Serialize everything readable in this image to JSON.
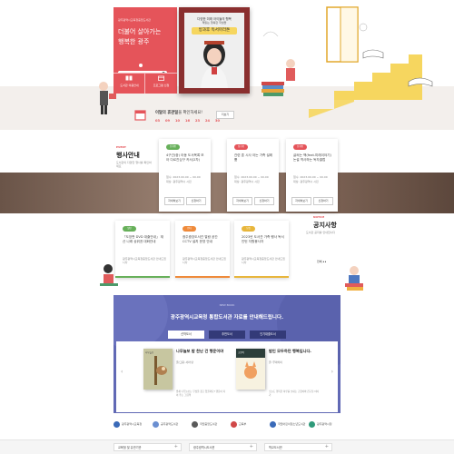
{
  "hero": {
    "red_top": "광주광역시교육청중앙도서관",
    "slogan_line1": "더불어 살아가는",
    "slogan_line2": "행복한 광주",
    "photo_caption_top": "다양한 미래 아이들의 행복",
    "photo_caption_sub": "책읽는 행복한 학생들",
    "photo_title": "방과후 독서마라톤",
    "tiles": [
      "도서관 이용안내",
      "프로그램 신청"
    ],
    "calendar_title": "이달의 휴관일",
    "calendar_suffix": "을 확인하세요!",
    "calendar_days": [
      "03",
      "09",
      "10",
      "16",
      "23",
      "24",
      "30"
    ],
    "calendar_more": "더보기"
  },
  "notices_a": {
    "section_title": "행사안내",
    "section_label": "EVENT",
    "section_desc": "도서관의 다양한 행사를 확인하세요",
    "more": "전체",
    "cards": [
      {
        "badge": "진행중",
        "title": "4구간(중) 아동 도서목록 모아 다르진심구 카서(2차)",
        "info1": "접수: 2023.00.00 ~ 00.00",
        "info2": "대상: 광주광역시 시민",
        "btn1": "자세히보기",
        "btn2": "신청하기"
      },
      {
        "badge": "접수중",
        "title": "관련 훈 시사 아는 가족 설레뿜",
        "info1": "접수: 2023.00.00 ~ 00.00",
        "info2": "대상: 광주광역시 시민",
        "btn1": "자세히보기",
        "btn2": "신청하기"
      },
      {
        "badge": "진행중",
        "title": "글써는 책(feat.미래이야기) 논설 역사하는 독자클럽",
        "info1": "접수: 2023.00.00 ~ 00.00",
        "info2": "대상: 광주광역시 시민",
        "btn1": "자세히보기",
        "btn2": "신청하기"
      }
    ]
  },
  "notices_b": {
    "section_title": "공지사항",
    "section_label": "NOTICE",
    "section_desc": "도서관 공지를 안내합니다",
    "more": "전체",
    "cards": [
      {
        "badge": "일반",
        "title": "「도장판 DVD 대출안내」 재산 나래 상위권 대화안내",
        "info": "광주광역시교육청중앙도서관 안내드립니다"
      },
      {
        "badge": "안내",
        "title": "광주중앙도서관 열람 공간 CCTV 설치 운영 안내",
        "info": "광주광역시교육청중앙도서관 안내드립니다"
      },
      {
        "badge": "모집",
        "title": "2023년 도서관 가족 행사 독서 인턴 자원봉사자",
        "info": "광주광역시교육청중앙도서관 안내드립니다"
      }
    ]
  },
  "books": {
    "label": "NEW BOOK",
    "heading": "광주광역시교육청 통합도서관 자료를 안내해드립니다.",
    "tabs": [
      "신착도서",
      "추천도서",
      "인기대출도서"
    ],
    "items": [
      {
        "cover_text": "나무늘보",
        "title": "나무늘보 밤 찬난 건 행운이야",
        "author": "글/그림: 사라 탄",
        "desc": "밤새 나무늘보는 무엇을 찾고 있을까요? 행운이 되어 주는 그림책"
      },
      {
        "cover_text": "고양이",
        "title": "밤인 모두하던 행복입니다.",
        "author": "글: 무라카미",
        "desc": "오늘도 행복한 하루를 보내는 고양이와 친구들 이야기"
      }
    ]
  },
  "partners": [
    "광주광역시교육청",
    "공주광역도서관",
    "국립중앙도서관",
    "교육부",
    "국립어린이청소년도서관",
    "광주광역시청"
  ],
  "footer": [
    "교육청 및 유관기관",
    "광주광역시도서관",
    "학교도서관"
  ],
  "colors": {
    "red": "#e5545a",
    "yellow": "#f6d65f",
    "purple": "#6169b5",
    "navy": "#333a78",
    "green": "#67b05a",
    "orange": "#ef8a3a",
    "gold": "#e8b63c"
  }
}
